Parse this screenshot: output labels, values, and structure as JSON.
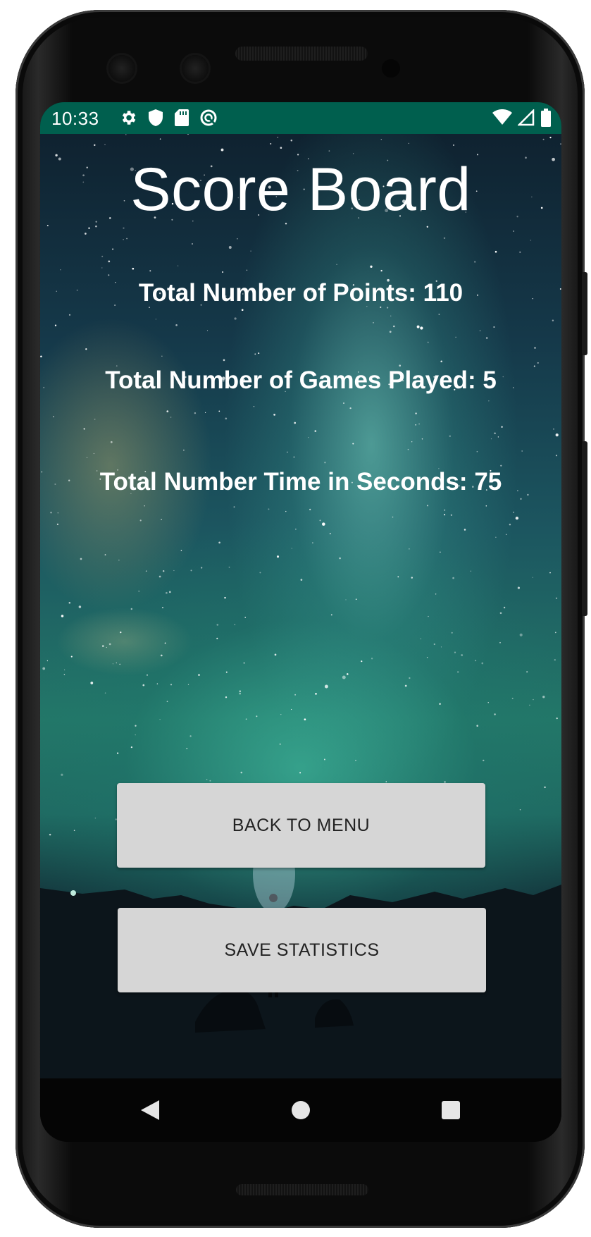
{
  "status_bar": {
    "time": "10:33",
    "left_icons": [
      "settings-icon",
      "shield-icon",
      "sd-card-icon",
      "sync-icon"
    ],
    "right_icons": [
      "wifi-icon",
      "cellular-signal-icon",
      "battery-icon"
    ],
    "background_color": "#005f4e"
  },
  "screen": {
    "title": "Score Board",
    "stats": {
      "points": "Total Number of Points: 110",
      "games": "Total Number of Games Played: 5",
      "time": "Total Number Time in Seconds: 75"
    },
    "buttons": {
      "back_to_menu": "BACK TO MENU",
      "save_statistics": "SAVE STATISTICS"
    },
    "button_color": "#d6d6d6"
  },
  "nav_bar": {
    "back": "back-triangle-icon",
    "home": "home-circle-icon",
    "recents": "recents-square-icon"
  }
}
